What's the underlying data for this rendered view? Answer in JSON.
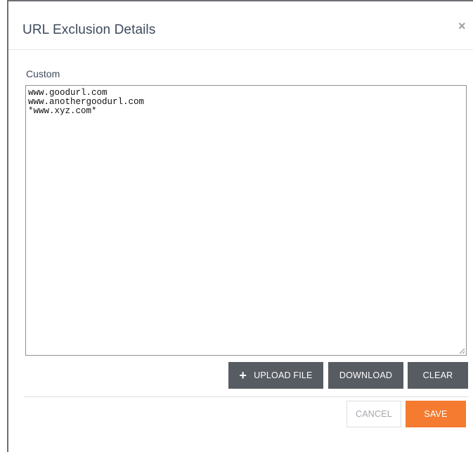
{
  "dialog": {
    "title": "URL Exclusion Details",
    "close_glyph": "×"
  },
  "custom_field": {
    "label": "Custom",
    "value": "www.goodurl.com\nwww.anothergoodurl.com\n*www.xyz.com*"
  },
  "actions": {
    "upload_label": "UPLOAD FILE",
    "upload_icon": "plus-icon",
    "plus_glyph": "+",
    "download_label": "DOWNLOAD",
    "clear_label": "CLEAR"
  },
  "footer": {
    "cancel_label": "CANCEL",
    "save_label": "SAVE"
  },
  "colors": {
    "save_accent": "#f47b30",
    "action_button_bg": "#575b62",
    "title_text": "#3d4a5c"
  }
}
